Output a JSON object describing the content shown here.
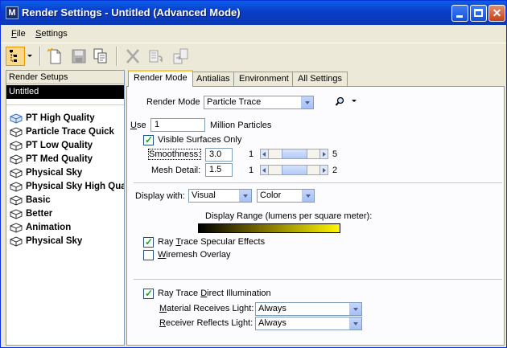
{
  "window": {
    "icon_glyph": "M",
    "title": "Render Settings - Untitled (Advanced Mode)",
    "close_glyph": "✕"
  },
  "menu": {
    "file_key": "F",
    "file_rest": "ile",
    "settings_key": "S",
    "settings_rest": "ettings"
  },
  "toolbar": {
    "icons": [
      "tree-view-icon",
      "dropdown-arrow-icon",
      "new-icon",
      "save-icon",
      "copy-icon",
      "delete-icon",
      "import-icon",
      "export-icon"
    ]
  },
  "left": {
    "header": "Render Setups",
    "current_file": "Untitled",
    "setups": [
      "PT High Quality",
      "Particle Trace Quick",
      "PT Low Quality",
      "PT Med Quality",
      "Physical Sky",
      "Physical Sky High Quality",
      "Basic",
      "Better",
      "Animation",
      "Physical Sky"
    ]
  },
  "tabs": [
    "Render Mode",
    "Antialias",
    "Environment",
    "All Settings"
  ],
  "render_mode": {
    "label": "Render Mode",
    "value": "Particle Trace"
  },
  "particles": {
    "use_key": "U",
    "use_rest": "se",
    "value": "1",
    "unit": "Million Particles"
  },
  "visible_surfaces": {
    "label": "Visible Surfaces Only",
    "checked": true
  },
  "smoothness": {
    "label": "Smoothness:",
    "value": "3.0",
    "min": "1",
    "max": "5",
    "level": 0.5
  },
  "mesh_detail": {
    "label": "Mesh Detail:",
    "value": "1.5",
    "min": "1",
    "max": "2",
    "level": 0.5
  },
  "display": {
    "label": "Display with:",
    "mode": "Visual",
    "channel": "Color",
    "range_label": "Display Range (lumens per square meter):"
  },
  "ray_trace_specular": {
    "prefix": "Ray ",
    "key": "T",
    "rest": "race Specular Effects",
    "checked": true
  },
  "wiremesh": {
    "key": "W",
    "rest": "iremesh Overlay",
    "checked": false
  },
  "ray_trace_direct": {
    "prefix": "Ray Trace ",
    "key": "D",
    "rest": "irect Illumination",
    "checked": true
  },
  "material_receives": {
    "key": "M",
    "rest": "aterial Receives Light:",
    "value": "Always"
  },
  "receiver_reflects": {
    "key": "R",
    "rest": "eceiver Reflects Light:",
    "value": "Always"
  }
}
